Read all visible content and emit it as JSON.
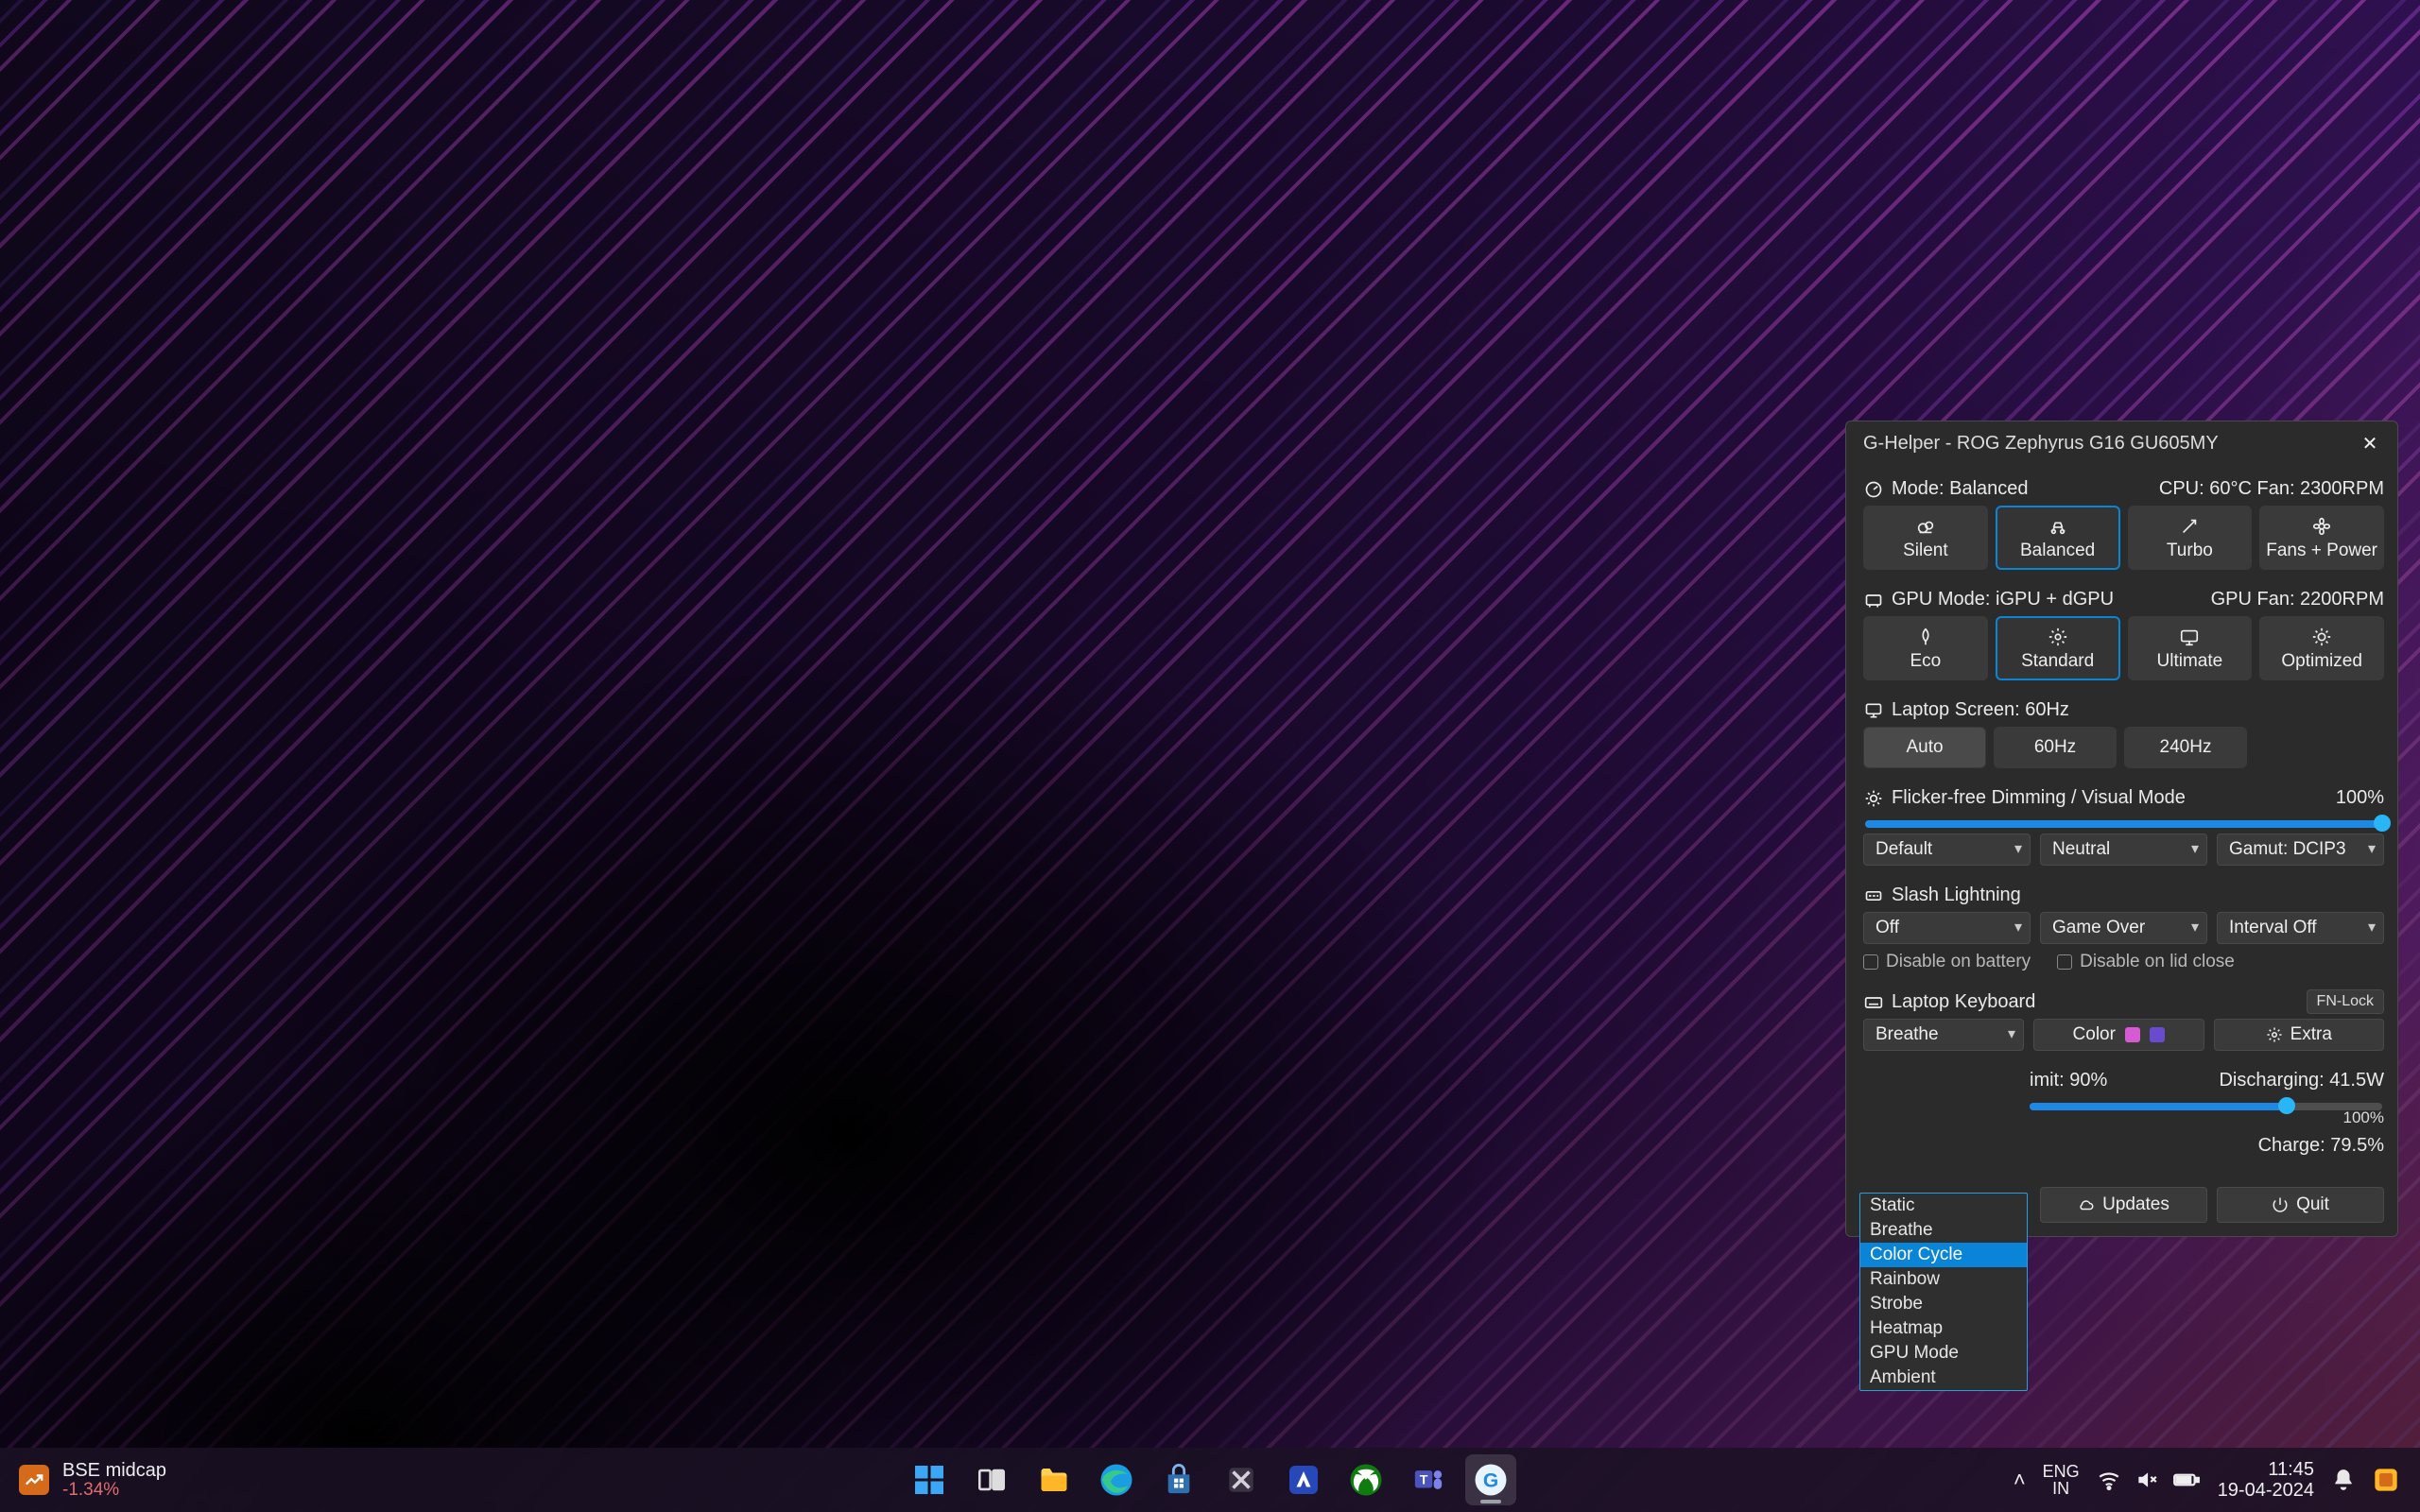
{
  "app": {
    "title": "G-Helper - ROG Zephyrus G16 GU605MY"
  },
  "mode": {
    "label": "Mode: Balanced",
    "status": "CPU: 60°C Fan: 2300RPM",
    "buttons": [
      "Silent",
      "Balanced",
      "Turbo",
      "Fans + Power"
    ],
    "selected": 1
  },
  "gpu": {
    "label": "GPU Mode: iGPU + dGPU",
    "status": "GPU Fan: 2200RPM",
    "buttons": [
      "Eco",
      "Standard",
      "Ultimate",
      "Optimized"
    ],
    "selected": 1
  },
  "screen": {
    "label": "Laptop Screen: 60Hz",
    "buttons": [
      "Auto",
      "60Hz",
      "240Hz"
    ],
    "selected": 0
  },
  "dimming": {
    "label": "Flicker-free Dimming / Visual Mode",
    "value": "100%",
    "dropdowns": [
      "Default",
      "Neutral",
      "Gamut: DCIP3"
    ]
  },
  "slash": {
    "label": "Slash Lightning",
    "dropdowns": [
      "Off",
      "Game Over",
      "Interval Off"
    ],
    "check1": "Disable on battery",
    "check2": "Disable on lid close"
  },
  "keyboard": {
    "label": "Laptop Keyboard",
    "fnlock": "FN-Lock",
    "mode": "Breathe",
    "color_label": "Color",
    "swatches": [
      "#d65ad1",
      "#6a4bd0"
    ],
    "extra_label": "Extra",
    "options": [
      "Static",
      "Breathe",
      "Color Cycle",
      "Rainbow",
      "Strobe",
      "Heatmap",
      "GPU Mode",
      "Ambient"
    ],
    "highlight": 2
  },
  "battery": {
    "label_partial": "imit: 90%",
    "right": "Discharging: 41.5W",
    "slider_pct": 73,
    "slider_label": "100%",
    "charge": "Charge: 79.5%"
  },
  "footer": {
    "updates": "Updates",
    "quit": "Quit"
  },
  "taskbar": {
    "stock_name": "BSE midcap",
    "stock_change": "-1.34%",
    "lang1": "ENG",
    "lang2": "IN",
    "time": "11:45",
    "date": "19-04-2024"
  }
}
